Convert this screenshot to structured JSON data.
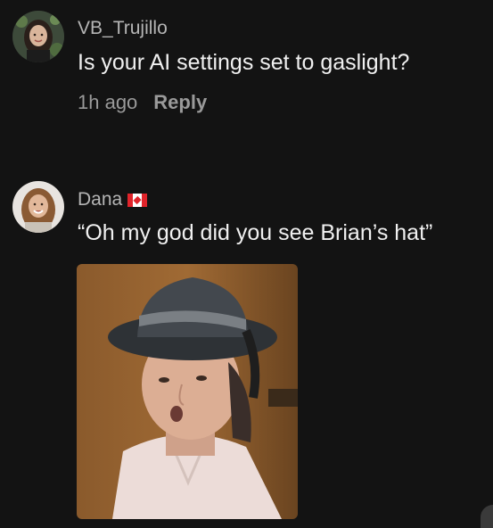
{
  "comments": [
    {
      "username": "VB_Trujillo",
      "text": "Is your AI settings set to gaslight?",
      "time": "1h ago",
      "reply_label": "Reply"
    },
    {
      "username": "Dana",
      "flag_icon": "canada-flag-icon",
      "text": "“Oh my god did you see Brian’s hat”",
      "attachment_icon": "gif-image"
    }
  ],
  "colors": {
    "background": "#131313",
    "username": "#b5b5b5",
    "text": "#f0f0f0",
    "meta": "#9a9a9a"
  }
}
